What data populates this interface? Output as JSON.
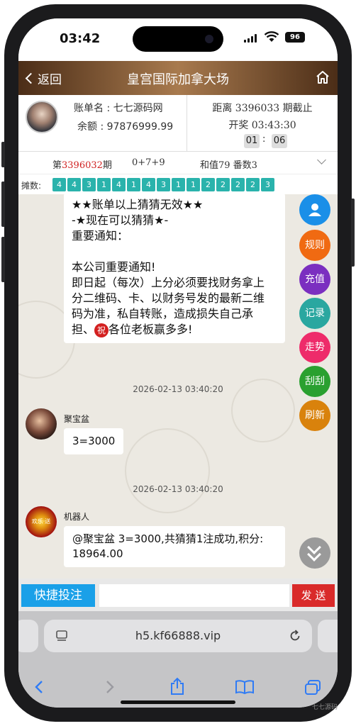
{
  "status_bar": {
    "time": "03:42",
    "battery": "96"
  },
  "header": {
    "back_label": "返回",
    "title": "皇宫国际加拿大场"
  },
  "account": {
    "name_label": "账单名 : 七七源码网",
    "balance_label": "余额 : 97876999.99"
  },
  "draw": {
    "period_label": "距离 3396033 期截止",
    "draw_time_label": "开奖 03:43:30",
    "countdown_min": "01",
    "countdown_sep": ":",
    "countdown_sec": "06"
  },
  "result": {
    "prefix": "第",
    "period": "3396032",
    "suffix": "期",
    "formula": "0+7+9",
    "sum_label": "和值79 番数3"
  },
  "trend": {
    "label": "摊数:",
    "values": [
      "4",
      "4",
      "3",
      "1",
      "4",
      "1",
      "4",
      "3",
      "1",
      "1",
      "2",
      "2",
      "2",
      "2",
      "3"
    ]
  },
  "notice": {
    "line1": "★★账单以上猜猜无效★★",
    "line2": "-★现在可以猜猜★-",
    "line3": "重要通知：",
    "line4": "本公司重要通知!",
    "line5": "即日起（每次）上分必须要找财务拿上",
    "line6": "分二维码、卡、以财务号发的最新二维",
    "line7": "码为准，私自转账，造成损失自己承",
    "line8a": "担、",
    "badge": "祝",
    "line8b": "各位老板赢多多!"
  },
  "messages": [
    {
      "time": "2026-02-13 03:40:20",
      "user": "聚宝盆",
      "text": "3=3000"
    },
    {
      "time": "2026-02-13 03:40:20",
      "user": "机器人",
      "avatar_text": "欢乐·送",
      "text_line1": "@聚宝盆 3=3000,共猜猜1注成功,积分:",
      "text_line2": "18964.00"
    }
  ],
  "side_buttons": [
    {
      "label": "",
      "icon": "user-icon",
      "color": "#1a8fe8"
    },
    {
      "label": "规则",
      "color": "#f06a12"
    },
    {
      "label": "充值",
      "color": "#7b2fc0"
    },
    {
      "label": "记录",
      "color": "#2aa7a0"
    },
    {
      "label": "走势",
      "color": "#ee2b6a"
    },
    {
      "label": "刮刮",
      "color": "#2aa030"
    },
    {
      "label": "刷新",
      "color": "#d9820c"
    }
  ],
  "input_bar": {
    "quick_label": "快捷投注",
    "message_placeholder": "",
    "send_label": "发 送"
  },
  "browser": {
    "url": "h5.kf66888.vip"
  },
  "watermark": "七七源码"
}
